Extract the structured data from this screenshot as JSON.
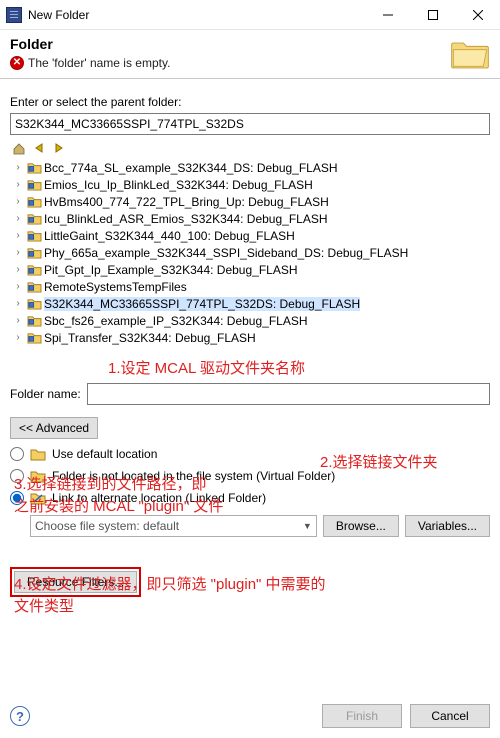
{
  "title": "New Folder",
  "banner": {
    "title": "Folder",
    "error": "The 'folder' name is empty."
  },
  "parentLabel": "Enter or select the parent folder:",
  "parentValue": "S32K344_MC33665SSPI_774TPL_S32DS",
  "tree": [
    {
      "label": "Bcc_774a_SL_example_S32K344_DS: Debug_FLASH",
      "sel": false
    },
    {
      "label": "Emios_Icu_Ip_BlinkLed_S32K344: Debug_FLASH",
      "sel": false
    },
    {
      "label": "HvBms400_774_722_TPL_Bring_Up: Debug_FLASH",
      "sel": false
    },
    {
      "label": "Icu_BlinkLed_ASR_Emios_S32K344: Debug_FLASH",
      "sel": false
    },
    {
      "label": "LittleGaint_S32K344_440_100: Debug_FLASH",
      "sel": false
    },
    {
      "label": "Phy_665a_example_S32K344_SSPI_Sideband_DS: Debug_FLASH",
      "sel": false
    },
    {
      "label": "Pit_Gpt_Ip_Example_S32K344: Debug_FLASH",
      "sel": false
    },
    {
      "label": "RemoteSystemsTempFiles",
      "sel": false
    },
    {
      "label": "S32K344_MC33665SSPI_774TPL_S32DS: Debug_FLASH",
      "sel": true
    },
    {
      "label": "Sbc_fs26_example_IP_S32K344: Debug_FLASH",
      "sel": false
    },
    {
      "label": "Spi_Transfer_S32K344: Debug_FLASH",
      "sel": false
    }
  ],
  "folderNameLabel": "Folder name:",
  "folderNameValue": "",
  "advanced": "<< Advanced",
  "opts": {
    "default": "Use default location",
    "virtual": "Folder is not located in the file system (Virtual Folder)",
    "linked": "Link to alternate location (Linked Folder)"
  },
  "chooseFs": "Choose file system: default",
  "browse": "Browse...",
  "variables": "Variables...",
  "resourceFilters": "Resource Filters...",
  "finish": "Finish",
  "cancel": "Cancel",
  "annots": {
    "a1": "1.设定 MCAL 驱动文件夹名称",
    "a2": "2.选择链接文件夹",
    "a3a": "3.选择链接到的文件路径，即",
    "a3b": "之前安装的 MCAL \"plugin\" 文件",
    "a4a": "4.设定文件过滤器，即只筛选 \"plugin\" 中需要的",
    "a4b": "文件类型"
  }
}
